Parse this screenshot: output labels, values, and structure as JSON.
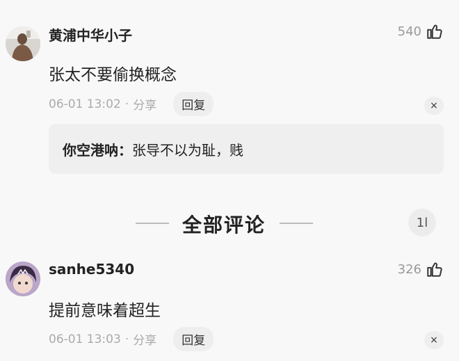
{
  "comments": [
    {
      "username": "黄浦中华小子",
      "likes": "540",
      "text": "张太不要偷换概念",
      "time": "06-01 13:02",
      "separator": "·",
      "share": "分享",
      "reply": "回复",
      "close": "×",
      "sub_reply": {
        "author": "你空港呐：",
        "text": "张导不以为耻，贱"
      }
    },
    {
      "username": "sanhe5340",
      "likes": "326",
      "text": "提前意味着超生",
      "time": "06-01 13:03",
      "separator": "·",
      "share": "分享",
      "reply": "回复",
      "close": "×"
    }
  ],
  "section": {
    "title": "全部评论",
    "sort_icon": "1l"
  },
  "colors": {
    "background": "#f8f8f8",
    "meta_text": "#aaaaaa",
    "pill_bg": "#eeeeee"
  }
}
